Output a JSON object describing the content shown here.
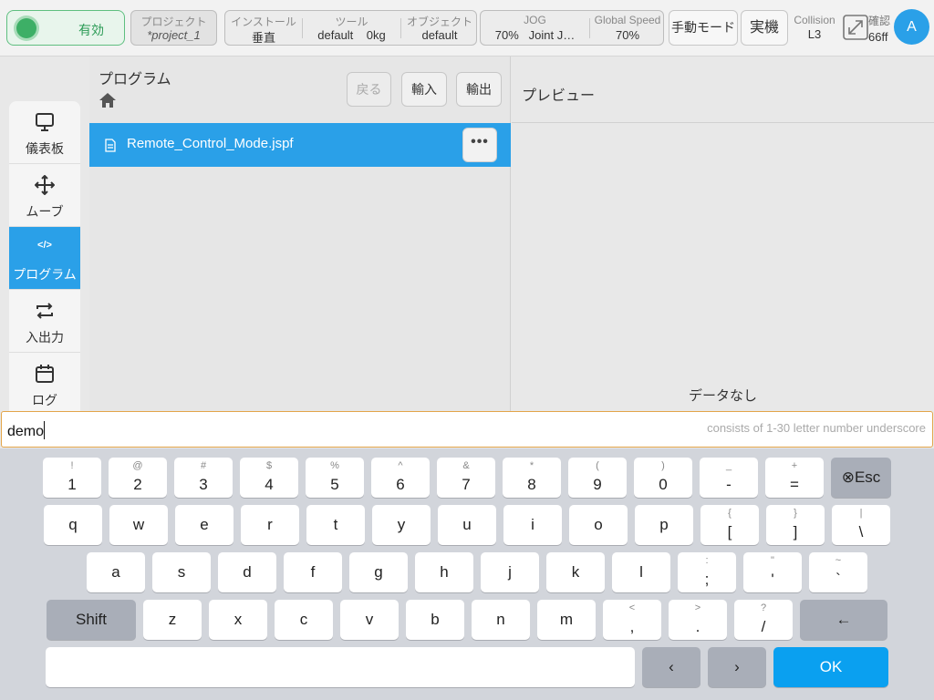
{
  "topbar": {
    "enable_label": "有効",
    "project": {
      "label": "プロジェクト",
      "value": "*project_1"
    },
    "install": {
      "label": "インストール",
      "value": "垂直"
    },
    "tool": {
      "label": "ツール",
      "value1": "default",
      "value2": "0kg"
    },
    "object": {
      "label": "オブジェクト",
      "value": "default"
    },
    "jog": {
      "label": "JOG",
      "value1": "70%",
      "value2": "Joint J…"
    },
    "global_speed": {
      "label": "Global Speed",
      "value": "70%"
    },
    "manual_mode": "手動モード",
    "real_machine": "実機",
    "collision": {
      "label": "Collision",
      "value": "L3"
    },
    "confirm": {
      "label": "確認",
      "value": "66ff"
    },
    "avatar": "A"
  },
  "sidebar": {
    "items": [
      {
        "label": "儀表板",
        "icon": "monitor-icon"
      },
      {
        "label": "ムーブ",
        "icon": "move-icon"
      },
      {
        "label": "プログラム",
        "icon": "code-icon"
      },
      {
        "label": "入出力",
        "icon": "repeat-icon"
      },
      {
        "label": "ログ",
        "icon": "calendar-icon"
      }
    ],
    "active_index": 2,
    "code_glyph": "</>"
  },
  "program": {
    "title": "プログラム",
    "back": "戻る",
    "import": "輸入",
    "export": "輸出",
    "file": "Remote_Control_Mode.jspf",
    "more": "•••"
  },
  "preview": {
    "title": "プレビュー",
    "empty": "データなし"
  },
  "input": {
    "value": "demo",
    "hint": "consists of 1-30 letter number underscore"
  },
  "keyboard": {
    "row1": [
      [
        "!",
        "1"
      ],
      [
        "@",
        "2"
      ],
      [
        "#",
        "3"
      ],
      [
        "$",
        "4"
      ],
      [
        "%",
        "5"
      ],
      [
        "^",
        "6"
      ],
      [
        "&",
        "7"
      ],
      [
        "*",
        "8"
      ],
      [
        "(",
        "9"
      ],
      [
        ")",
        "0"
      ],
      [
        "_",
        "-"
      ],
      [
        "+",
        "="
      ]
    ],
    "esc": "⊗Esc",
    "row2": [
      [
        "",
        "q"
      ],
      [
        "",
        "w"
      ],
      [
        "",
        "e"
      ],
      [
        "",
        "r"
      ],
      [
        "",
        "t"
      ],
      [
        "",
        "y"
      ],
      [
        "",
        "u"
      ],
      [
        "",
        "i"
      ],
      [
        "",
        "o"
      ],
      [
        "",
        "p"
      ],
      [
        "{",
        "["
      ],
      [
        "}",
        "]"
      ],
      [
        "|",
        "\\"
      ]
    ],
    "row3": [
      [
        "",
        "a"
      ],
      [
        "",
        "s"
      ],
      [
        "",
        "d"
      ],
      [
        "",
        "f"
      ],
      [
        "",
        "g"
      ],
      [
        "",
        "h"
      ],
      [
        "",
        "j"
      ],
      [
        "",
        "k"
      ],
      [
        "",
        "l"
      ],
      [
        ":",
        ";"
      ],
      [
        "\"",
        "'"
      ],
      [
        "~",
        "`"
      ]
    ],
    "shift": "Shift",
    "row4": [
      [
        "",
        "z"
      ],
      [
        "",
        "x"
      ],
      [
        "",
        "c"
      ],
      [
        "",
        "v"
      ],
      [
        "",
        "b"
      ],
      [
        "",
        "n"
      ],
      [
        "",
        "m"
      ],
      [
        "<",
        ","
      ],
      [
        ">",
        "."
      ],
      [
        "?",
        "/"
      ]
    ],
    "backspace": "←",
    "left": "‹",
    "right": "›",
    "ok": "OK"
  }
}
